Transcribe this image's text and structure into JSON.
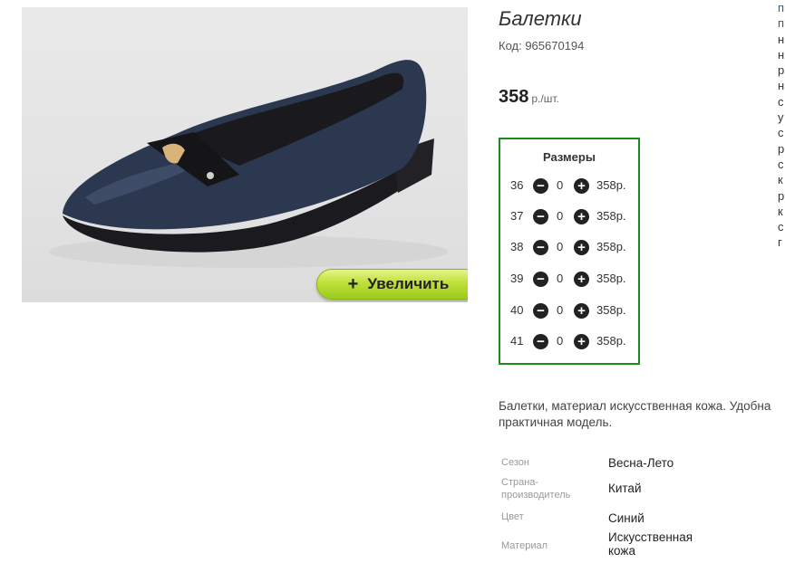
{
  "product": {
    "title": "Балетки",
    "code_label": "Код: 965670194",
    "price": "358",
    "price_unit": "р./шт.",
    "zoom_button_label": "Увеличить",
    "zoom_button_icon": "+"
  },
  "sizes": {
    "heading": "Размеры",
    "rows": [
      {
        "size": "36",
        "qty": "0",
        "price": "358р."
      },
      {
        "size": "37",
        "qty": "0",
        "price": "358р."
      },
      {
        "size": "38",
        "qty": "0",
        "price": "358р."
      },
      {
        "size": "39",
        "qty": "0",
        "price": "358р."
      },
      {
        "size": "40",
        "qty": "0",
        "price": "358р."
      },
      {
        "size": "41",
        "qty": "0",
        "price": "358р."
      }
    ],
    "minus_glyph": "−",
    "plus_glyph": "+"
  },
  "description": {
    "line1": "Балетки, материал искусственная кожа. Удобна",
    "line2": "практичная модель."
  },
  "properties": [
    {
      "key": "Сезон",
      "value": "Весна-Лето"
    },
    {
      "key": "Страна-производитель",
      "value": "Китай"
    },
    {
      "key": "Цвет",
      "value": "Синий"
    },
    {
      "key": "Материал",
      "value": "Искусственная кожа"
    }
  ],
  "side_strip": [
    "п",
    "п",
    "н",
    "н",
    "р",
    "н",
    "с",
    "у",
    "с",
    "р",
    "с",
    "к",
    "р",
    "к",
    "с",
    "г"
  ],
  "colors": {
    "sizes_border": "#1d8a1d",
    "zoom_button": "#9bcb1c",
    "shoe": "#263349"
  }
}
